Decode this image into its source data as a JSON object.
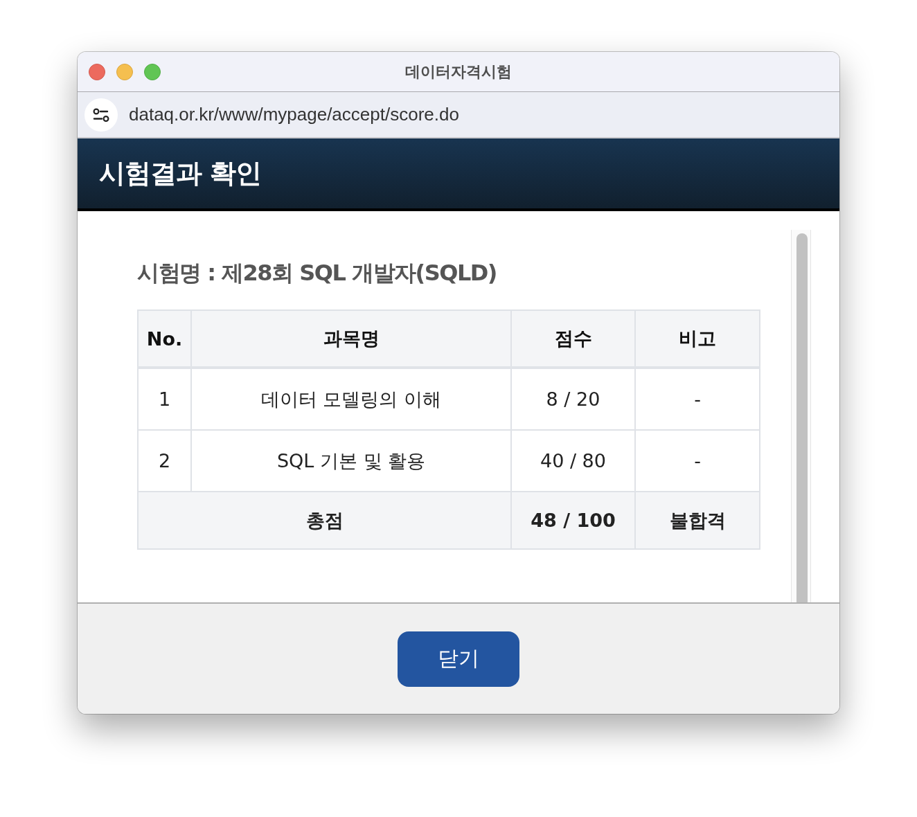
{
  "window": {
    "title": "데이터자격시험"
  },
  "address_bar": {
    "url": "dataq.or.kr/www/mypage/accept/score.do"
  },
  "header": {
    "title": "시험결과 확인"
  },
  "exam": {
    "name": "시험명 : 제28회 SQL 개발자(SQLD)"
  },
  "table": {
    "columns": [
      "No.",
      "과목명",
      "점수",
      "비고"
    ],
    "rows": [
      {
        "no": "1",
        "subject": "데이터 모델링의 이해",
        "score": "8 / 20",
        "note": "-"
      },
      {
        "no": "2",
        "subject": "SQL 기본 및 활용",
        "score": "40 / 80",
        "note": "-"
      }
    ],
    "total": {
      "label": "총점",
      "score": "48 / 100",
      "result": "불합격"
    }
  },
  "buttons": [
    {
      "label": "닫기"
    }
  ]
}
